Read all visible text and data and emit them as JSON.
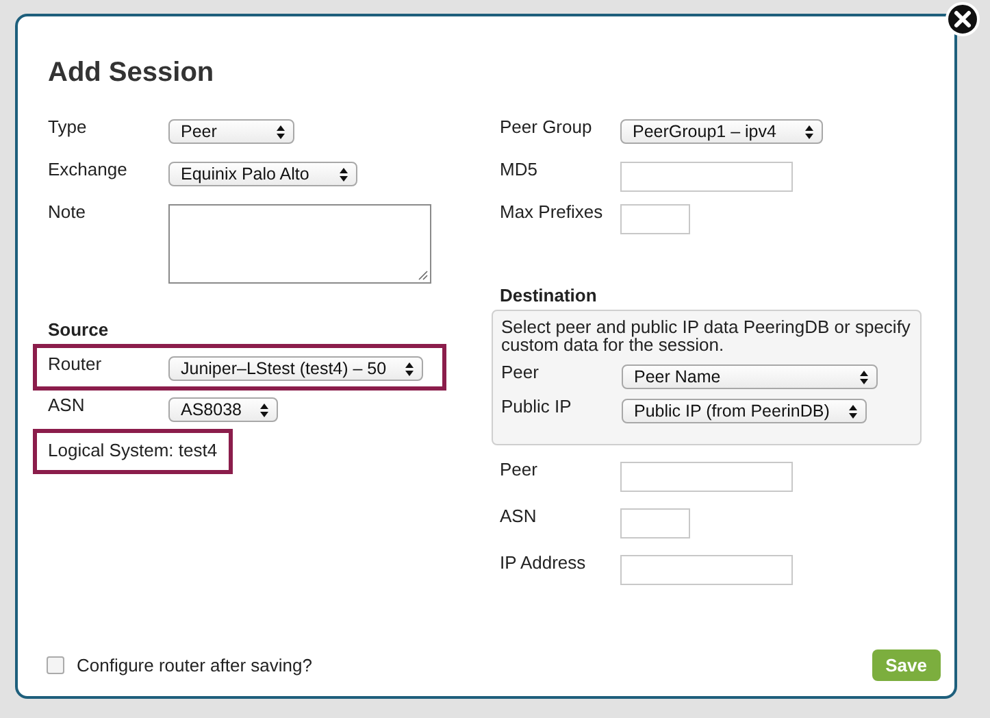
{
  "dialog": {
    "title": "Add Session",
    "left_fields": [
      {
        "label": "Type",
        "kind": "select",
        "value": "Peer"
      },
      {
        "label": "Exchange",
        "kind": "select",
        "value": "Equinix Palo Alto"
      },
      {
        "label": "Note",
        "kind": "textarea"
      }
    ],
    "right_fields": [
      {
        "label": "Peer Group",
        "kind": "select",
        "value": "PeerGroup1 – ipv4"
      },
      {
        "label": "MD5",
        "kind": "input"
      },
      {
        "label": "Max Prefixes",
        "kind": "input"
      }
    ],
    "source": {
      "heading": "Source",
      "fields": [
        {
          "label": "Router",
          "kind": "select",
          "value": "Juniper–LStest (test4) – 50",
          "highlighted": true
        },
        {
          "label": "ASN",
          "kind": "select",
          "value": "AS8038",
          "highlighted": false
        }
      ],
      "logical_system": {
        "text": "Logical System: test4",
        "highlighted": true
      }
    },
    "destination": {
      "heading": "Destination",
      "hint": "Select peer and public IP data PeeringDB or specify custom data for the session.",
      "lookup_fields": [
        {
          "label": "Peer",
          "kind": "select",
          "value": "Peer Name"
        },
        {
          "label": "Public IP",
          "kind": "select",
          "value": "Public IP (from PeerinDB)"
        }
      ],
      "fields": [
        {
          "label": "Peer",
          "kind": "input"
        },
        {
          "label": "ASN",
          "kind": "input"
        },
        {
          "label": "IP Address",
          "kind": "input"
        }
      ]
    },
    "configure_checkbox": {
      "label": "Configure router after saving?",
      "checked": false
    },
    "save_button": "Save"
  }
}
